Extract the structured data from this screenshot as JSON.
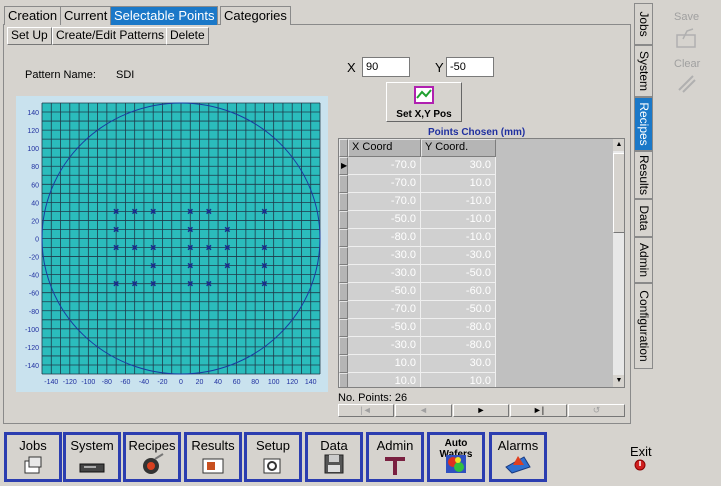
{
  "top_tabs": [
    "Creation",
    "Current",
    "Selectable Points",
    "Categories"
  ],
  "sub_tabs": [
    "Set Up",
    "Create/Edit Patterns",
    "Delete"
  ],
  "pattern": {
    "label": "Pattern Name:",
    "value": "SDI"
  },
  "coords": {
    "x_label": "X",
    "x_value": "90",
    "y_label": "Y",
    "y_value": "-50"
  },
  "set_button": "Set X,Y Pos",
  "points_title": "Points Chosen (mm)",
  "table": {
    "headers": [
      "X Coord",
      "Y Coord."
    ],
    "rows": [
      [
        "-70.0",
        "30.0"
      ],
      [
        "-70.0",
        "10.0"
      ],
      [
        "-70.0",
        "-10.0"
      ],
      [
        "-50.0",
        "-10.0"
      ],
      [
        "-80.0",
        "-10.0"
      ],
      [
        "-30.0",
        "-30.0"
      ],
      [
        "-30.0",
        "-50.0"
      ],
      [
        "-50.0",
        "-60.0"
      ],
      [
        "-70.0",
        "-50.0"
      ],
      [
        "-50.0",
        "-80.0"
      ],
      [
        "-30.0",
        "-80.0"
      ],
      [
        "10.0",
        "30.0"
      ],
      [
        "10.0",
        "10.0"
      ]
    ]
  },
  "points_count": "No. Points: 26",
  "pager_glyphs": [
    "|◄",
    "◄",
    "►",
    "►|",
    "↺"
  ],
  "right_tabs": [
    "Jobs",
    "System",
    "Recipes",
    "Results",
    "Data",
    "Admin",
    "Configuration"
  ],
  "side_actions": {
    "save": "Save",
    "clear": "Clear"
  },
  "nav_buttons": [
    {
      "label": "Jobs",
      "icon": "jobs-icon"
    },
    {
      "label": "System",
      "icon": "system-icon"
    },
    {
      "label": "Recipes",
      "icon": "recipes-icon"
    },
    {
      "label": "Results",
      "icon": "results-icon"
    },
    {
      "label": "Setup",
      "icon": "setup-icon"
    },
    {
      "label": "Data",
      "icon": "data-icon"
    },
    {
      "label": "Admin",
      "icon": "admin-icon"
    },
    {
      "label": "Auto Wafers",
      "icon": "auto-wafers-icon"
    },
    {
      "label": "Alarms",
      "icon": "alarms-icon"
    }
  ],
  "exit": "Exit",
  "colors": {
    "accent": "#1a78c8",
    "wafer_bg": "#2bbcbc",
    "nav_border": "#2b3db0"
  },
  "chart_data": {
    "type": "scatter",
    "x_ticks": [
      "-140",
      "-120",
      "-100",
      "-80",
      "-60",
      "-40",
      "-20",
      "0",
      "20",
      "40",
      "60",
      "80",
      "100",
      "120",
      "140"
    ],
    "y_ticks": [
      "140",
      "120",
      "100",
      "80",
      "60",
      "40",
      "20",
      "0",
      "-20",
      "-40",
      "-60",
      "-80",
      "-100",
      "-120",
      "-140"
    ],
    "xlim": [
      -150,
      150
    ],
    "ylim": [
      -150,
      150
    ],
    "wafer_radius": 150,
    "marker": "x",
    "points": [
      [
        -70,
        30
      ],
      [
        -50,
        30
      ],
      [
        -30,
        30
      ],
      [
        10,
        30
      ],
      [
        30,
        30
      ],
      [
        90,
        30
      ],
      [
        -70,
        10
      ],
      [
        10,
        10
      ],
      [
        50,
        10
      ],
      [
        -70,
        -10
      ],
      [
        -50,
        -10
      ],
      [
        -30,
        -10
      ],
      [
        10,
        -10
      ],
      [
        30,
        -10
      ],
      [
        50,
        -10
      ],
      [
        90,
        -10
      ],
      [
        -30,
        -30
      ],
      [
        10,
        -30
      ],
      [
        50,
        -30
      ],
      [
        90,
        -30
      ],
      [
        -70,
        -50
      ],
      [
        -50,
        -50
      ],
      [
        -30,
        -50
      ],
      [
        10,
        -50
      ],
      [
        30,
        -50
      ],
      [
        90,
        -50
      ]
    ]
  }
}
